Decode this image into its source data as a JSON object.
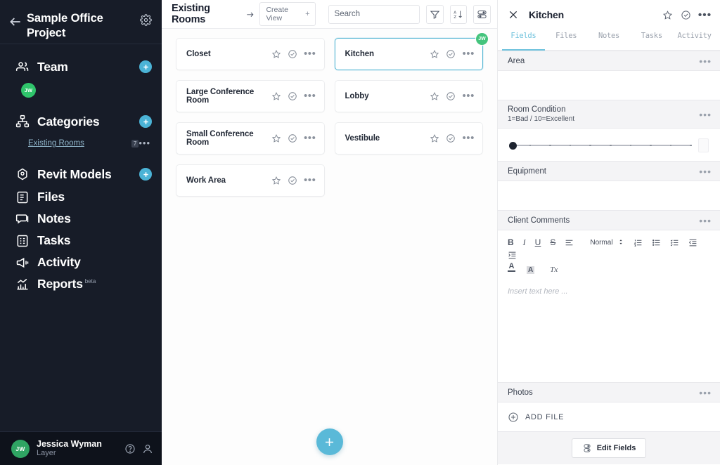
{
  "sidebar": {
    "project_title": "Sample Office Project",
    "back_icon": "arrow-left-icon",
    "gear_icon": "gear-icon",
    "team": {
      "label": "Team",
      "icon": "people-icon",
      "add_label": "+",
      "members": [
        {
          "initials": "JW",
          "color": "#2fc46b"
        }
      ]
    },
    "categories": {
      "label": "Categories",
      "icon": "sitemap-icon",
      "add_label": "+",
      "items": [
        {
          "label": "Existing Rooms",
          "count": "7"
        }
      ]
    },
    "nav": [
      {
        "label": "Revit Models",
        "icon": "revit-icon",
        "has_add": true
      },
      {
        "label": "Files",
        "icon": "file-icon",
        "has_add": false
      },
      {
        "label": "Notes",
        "icon": "notes-icon",
        "has_add": false
      },
      {
        "label": "Tasks",
        "icon": "tasks-icon",
        "has_add": false
      },
      {
        "label": "Activity",
        "icon": "megaphone-icon",
        "has_add": false
      },
      {
        "label": "Reports",
        "icon": "reports-icon",
        "has_add": false,
        "badge": "beta"
      }
    ],
    "user": {
      "initials": "JW",
      "name": "Jessica Wyman",
      "org": "Layer",
      "help_icon": "question-circle-icon",
      "account_icon": "person-icon"
    }
  },
  "main": {
    "toolbar": {
      "view_title": "Existing Rooms",
      "arrow_icon": "arrow-right-icon",
      "create_view_label": "Create View",
      "create_view_plus": "+",
      "search_placeholder": "Search",
      "search_value": "",
      "filter_icon": "filter-icon",
      "sort_icon": "sort-az-icon",
      "group_icon": "group-icon"
    },
    "cards": [
      {
        "name": "Closet",
        "selected": false,
        "avatar": null
      },
      {
        "name": "Kitchen",
        "selected": true,
        "avatar": "JW"
      },
      {
        "name": "Large Conference Room",
        "selected": false,
        "avatar": null
      },
      {
        "name": "Lobby",
        "selected": false,
        "avatar": null
      },
      {
        "name": "Small Conference Room",
        "selected": false,
        "avatar": null
      },
      {
        "name": "Vestibule",
        "selected": false,
        "avatar": null
      },
      {
        "name": "Work Area",
        "selected": false,
        "avatar": null
      }
    ],
    "card_icons": {
      "star": "star-icon",
      "check": "check-circle-icon",
      "more": "•••"
    },
    "fab": {
      "icon": "plus-icon",
      "color": "#5ab9d8"
    }
  },
  "panel": {
    "close_icon": "close-icon",
    "title": "Kitchen",
    "star_icon": "star-icon",
    "check_icon": "check-circle-icon",
    "more_label": "•••",
    "tabs": [
      {
        "label": "Fields",
        "active": true
      },
      {
        "label": "Files",
        "active": false
      },
      {
        "label": "Notes",
        "active": false
      },
      {
        "label": "Tasks",
        "active": false
      },
      {
        "label": "Activity",
        "active": false
      }
    ],
    "fields": [
      {
        "label": "Area",
        "sub": "",
        "type": "empty",
        "more": "•••"
      },
      {
        "label": "Room Condition",
        "sub": "1=Bad / 10=Excellent",
        "type": "slider",
        "more": "•••",
        "slider": {
          "min": 1,
          "max": 10,
          "value": 1,
          "ticks": 10,
          "value_box": ""
        }
      },
      {
        "label": "Equipment",
        "sub": "",
        "type": "empty",
        "more": "•••"
      },
      {
        "label": "Client Comments",
        "sub": "",
        "type": "richtext",
        "more": "•••"
      },
      {
        "label": "Photos",
        "sub": "",
        "type": "files",
        "more": "•••"
      }
    ],
    "richtext": {
      "buttons_row1": [
        "bold-icon",
        "italic-icon",
        "underline-icon",
        "strikethrough-icon",
        "align-icon"
      ],
      "labels_row1": [
        "B",
        "I",
        "U",
        "S",
        ""
      ],
      "style_label": "Normal",
      "spinner_icon": "updown-caret-icon",
      "list_icons": [
        "ordered-list-icon",
        "bullet-list-icon",
        "check-list-icon",
        "outdent-icon",
        "indent-icon"
      ],
      "buttons_row2": [
        "text-color-icon",
        "highlight-icon",
        "clear-format-icon"
      ],
      "labels_row2": [
        "A",
        "A",
        "Tx"
      ],
      "placeholder": "Insert text here ..."
    },
    "add_file": {
      "label": "ADD FILE",
      "icon": "plus-circle-icon"
    },
    "footer": {
      "edit_fields_label": "Edit Fields",
      "icon": "fields-icon"
    }
  }
}
